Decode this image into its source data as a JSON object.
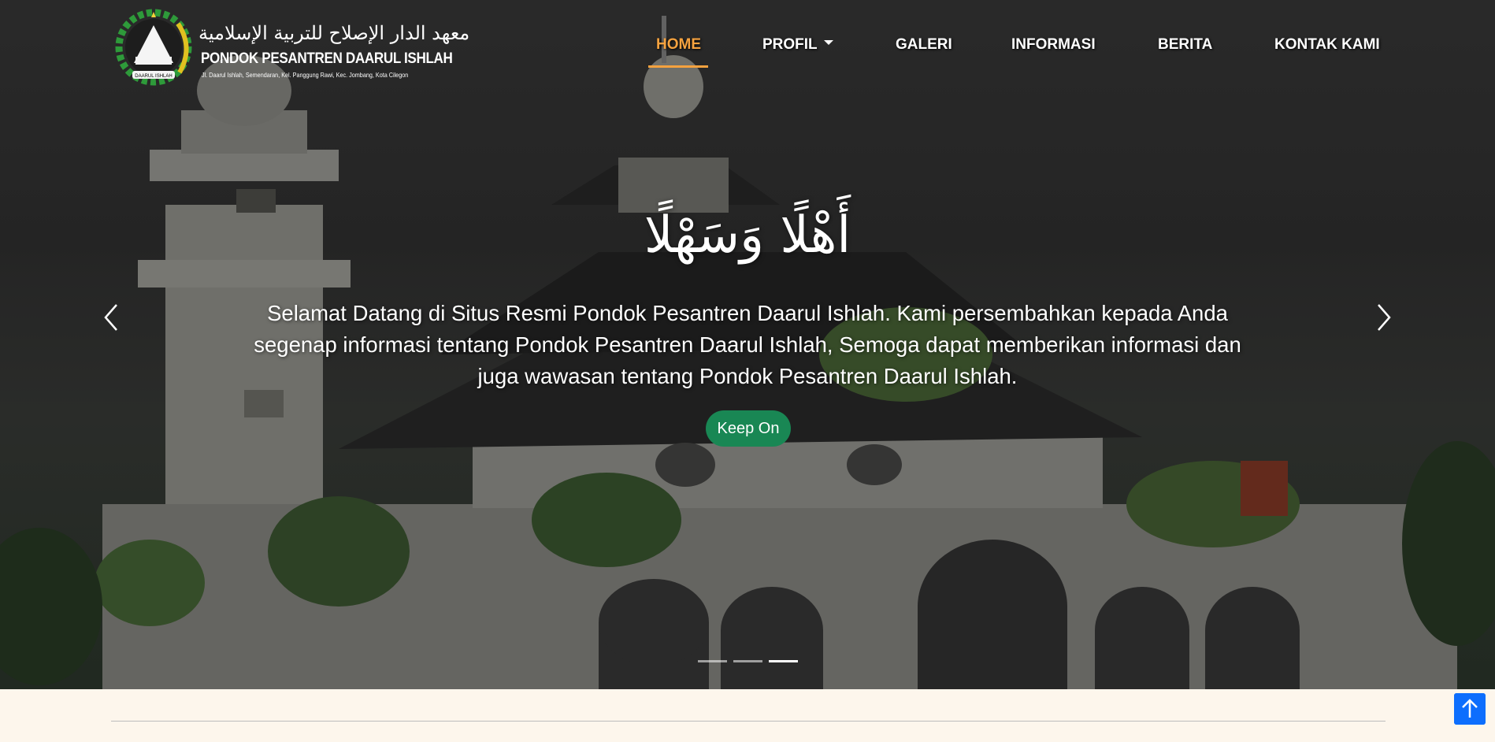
{
  "logo": {
    "arabic": "معهد الدار الإصلاح للتربية الإسلامية",
    "name": "PONDOK PESANTREN DAARUL ISHLAH",
    "address": "Jl. Daarul Ishlah, Semendaran, Kel. Panggung Rawi, Kec. Jombang, Kota Cilegon",
    "emblem_text": "DAARUL ISHLAH",
    "icon": "pesantren-emblem-icon"
  },
  "nav": {
    "home": "HOME",
    "profil": "PROFIL",
    "galeri": "GALERI",
    "informasi": "INFORMASI",
    "berita": "BERITA",
    "kontak": "KONTAK KAMI",
    "active_color": "#f5a23f"
  },
  "carousel": {
    "title": "أَهْلًا وَسَهْلًا",
    "text": "Selamat Datang di Situs Resmi Pondok Pesantren Daarul Ishlah. Kami persembahkan kepada Anda segenap informasi tentang Pondok Pesantren Daarul Ishlah, Semoga dapat memberikan informasi dan juga wawasan tentang Pondok Pesantren Daarul Ishlah.",
    "button_label": "Keep On",
    "button_color": "#198754",
    "slide_count": 3,
    "active_slide": 3,
    "prev_icon": "chevron-left-icon",
    "next_icon": "chevron-right-icon"
  },
  "scroll_top": {
    "icon": "arrow-up-icon",
    "color": "#0d6efd"
  }
}
